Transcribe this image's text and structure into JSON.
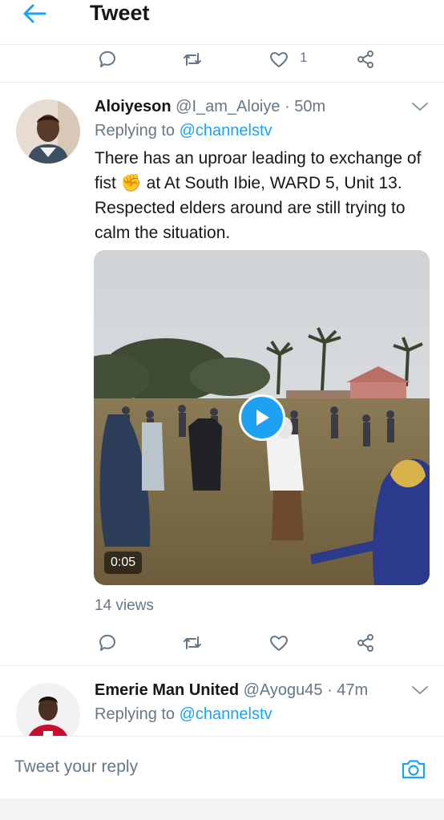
{
  "header": {
    "title": "Tweet"
  },
  "top_actions": {
    "like_count": "1"
  },
  "tweet": {
    "name": "Aloiyeson",
    "handle": "@I_am_Aloiye",
    "time": "50m",
    "replying_prefix": "Replying to ",
    "replying_to": "@channelstv",
    "text": "There has an uproar leading to exchange of fist ✊ at At South Ibie, WARD 5, Unit 13. Respected elders around are still trying to calm the situation.",
    "video_duration": "0:05",
    "views": "14 views"
  },
  "next_tweet": {
    "name": "Emerie Man United",
    "handle": "@Ayogu45",
    "time": "47m",
    "replying_prefix": "Replying to ",
    "replying_to": "@channelstv"
  },
  "reply_bar": {
    "placeholder": "Tweet your reply"
  },
  "colors": {
    "accent": "#1da1f2",
    "muted": "#657786",
    "text": "#14171a",
    "divider": "#e6ecf0"
  },
  "icons": [
    "back-arrow-icon",
    "reply-icon",
    "retweet-icon",
    "like-icon",
    "share-icon",
    "chevron-down-icon",
    "play-icon",
    "camera-icon"
  ]
}
